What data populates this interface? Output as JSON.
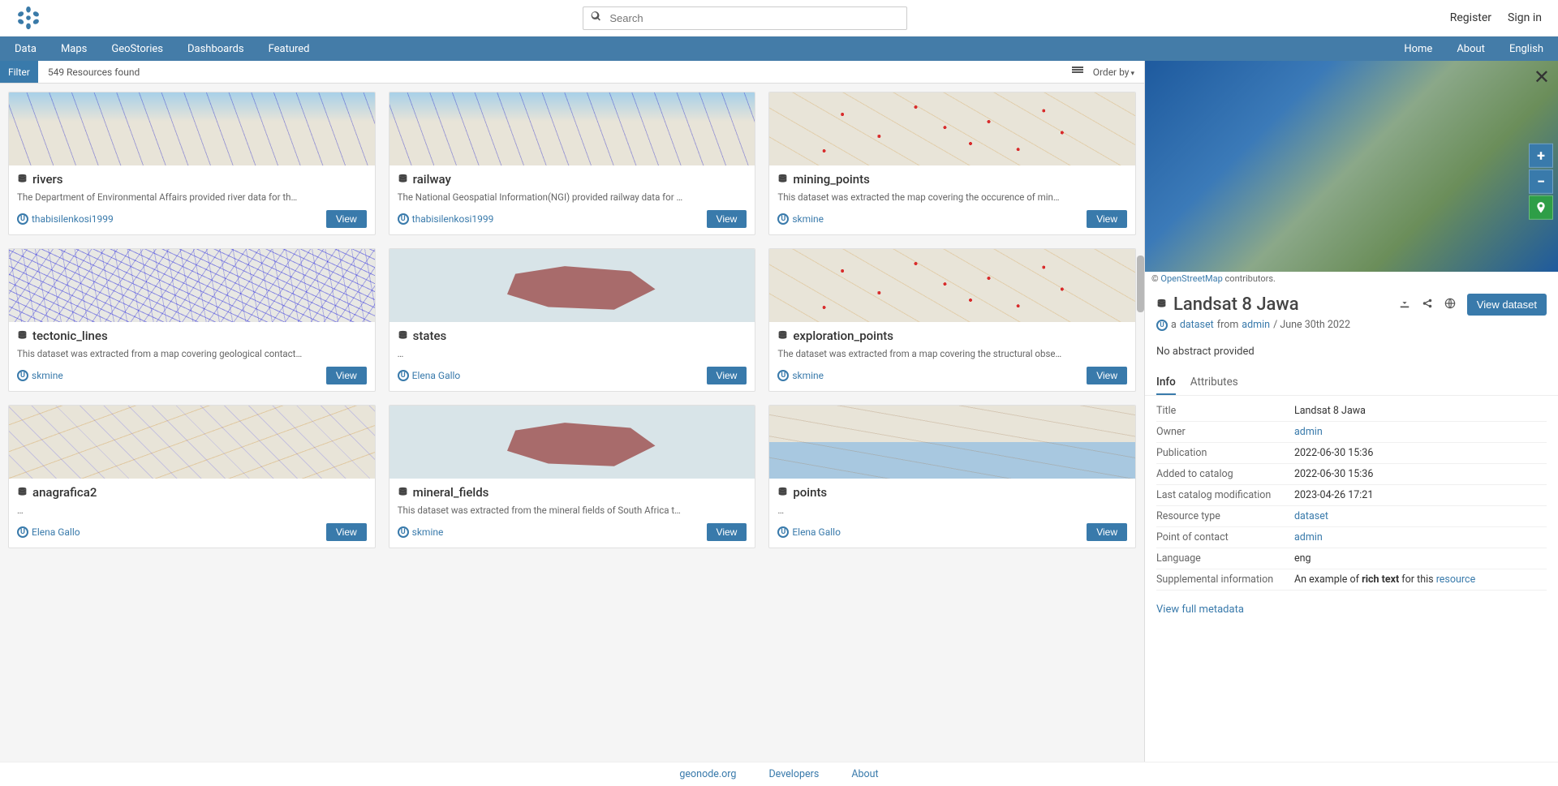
{
  "search": {
    "placeholder": "Search"
  },
  "toplinks": {
    "register": "Register",
    "signin": "Sign in"
  },
  "nav": {
    "left": [
      "Data",
      "Maps",
      "GeoStories",
      "Dashboards",
      "Featured"
    ],
    "right": [
      "Home",
      "About",
      "English"
    ]
  },
  "filterbar": {
    "filter": "Filter",
    "count": "549 Resources found",
    "orderby": "Order by"
  },
  "cards": [
    {
      "title": "rivers",
      "desc": "The Department of Environmental Affairs provided river data for th…",
      "author": "thabisilenkosi1999",
      "view": "View",
      "thumb": "bluewater"
    },
    {
      "title": "railway",
      "desc": "The National Geospatial Information(NGI) provided railway data for …",
      "author": "thabisilenkosi1999",
      "view": "View",
      "thumb": "bluewater"
    },
    {
      "title": "mining_points",
      "desc": "This dataset was extracted the map covering the occurence of min…",
      "author": "skmine",
      "view": "View",
      "thumb": "redpoints"
    },
    {
      "title": "tectonic_lines",
      "desc": "This dataset was extracted from a map covering geological contact…",
      "author": "skmine",
      "view": "View",
      "thumb": "bluelines"
    },
    {
      "title": "states",
      "desc": "…",
      "author": "Elena Gallo",
      "view": "View",
      "thumb": "brownpoly"
    },
    {
      "title": "exploration_points",
      "desc": "The dataset was extracted from a map covering the structural obse…",
      "author": "skmine",
      "view": "View",
      "thumb": "redpoints"
    },
    {
      "title": "anagrafica2",
      "desc": "…",
      "author": "Elena Gallo",
      "view": "View",
      "thumb": "roads"
    },
    {
      "title": "mineral_fields",
      "desc": "This dataset was extracted from the mineral fields of South Africa t…",
      "author": "skmine",
      "view": "View",
      "thumb": "brownpoly"
    },
    {
      "title": "points",
      "desc": "…",
      "author": "Elena Gallo",
      "view": "View",
      "thumb": "harbor"
    }
  ],
  "detail": {
    "attrib_prefix": "© ",
    "attrib_link": "OpenStreetMap",
    "attrib_suffix": " contributors.",
    "title": "Landsat 8 Jawa",
    "viewdataset": "View dataset",
    "sub_a": "a ",
    "sub_dataset": "dataset",
    "sub_from": " from ",
    "sub_admin": "admin",
    "sub_date": " / June 30th 2022",
    "abstract": "No abstract provided",
    "tabs": {
      "info": "Info",
      "attributes": "Attributes"
    },
    "meta": [
      {
        "k": "Title",
        "v": "Landsat 8 Jawa"
      },
      {
        "k": "Owner",
        "v": "admin",
        "link": true
      },
      {
        "k": "Publication",
        "v": "2022-06-30 15:36"
      },
      {
        "k": "Added to catalog",
        "v": "2022-06-30 15:36"
      },
      {
        "k": "Last catalog modification",
        "v": "2023-04-26 17:21"
      },
      {
        "k": "Resource type",
        "v": "dataset",
        "link": true
      },
      {
        "k": "Point of contact",
        "v": "admin",
        "link": true
      },
      {
        "k": "Language",
        "v": "eng"
      }
    ],
    "supp_label": "Supplemental information",
    "supp_pre": "An example of ",
    "supp_bold": "rich text",
    "supp_mid": " for this ",
    "supp_link": "resource",
    "viewfull": "View full metadata"
  },
  "footer": {
    "a": "geonode.org",
    "b": "Developers",
    "c": "About"
  }
}
